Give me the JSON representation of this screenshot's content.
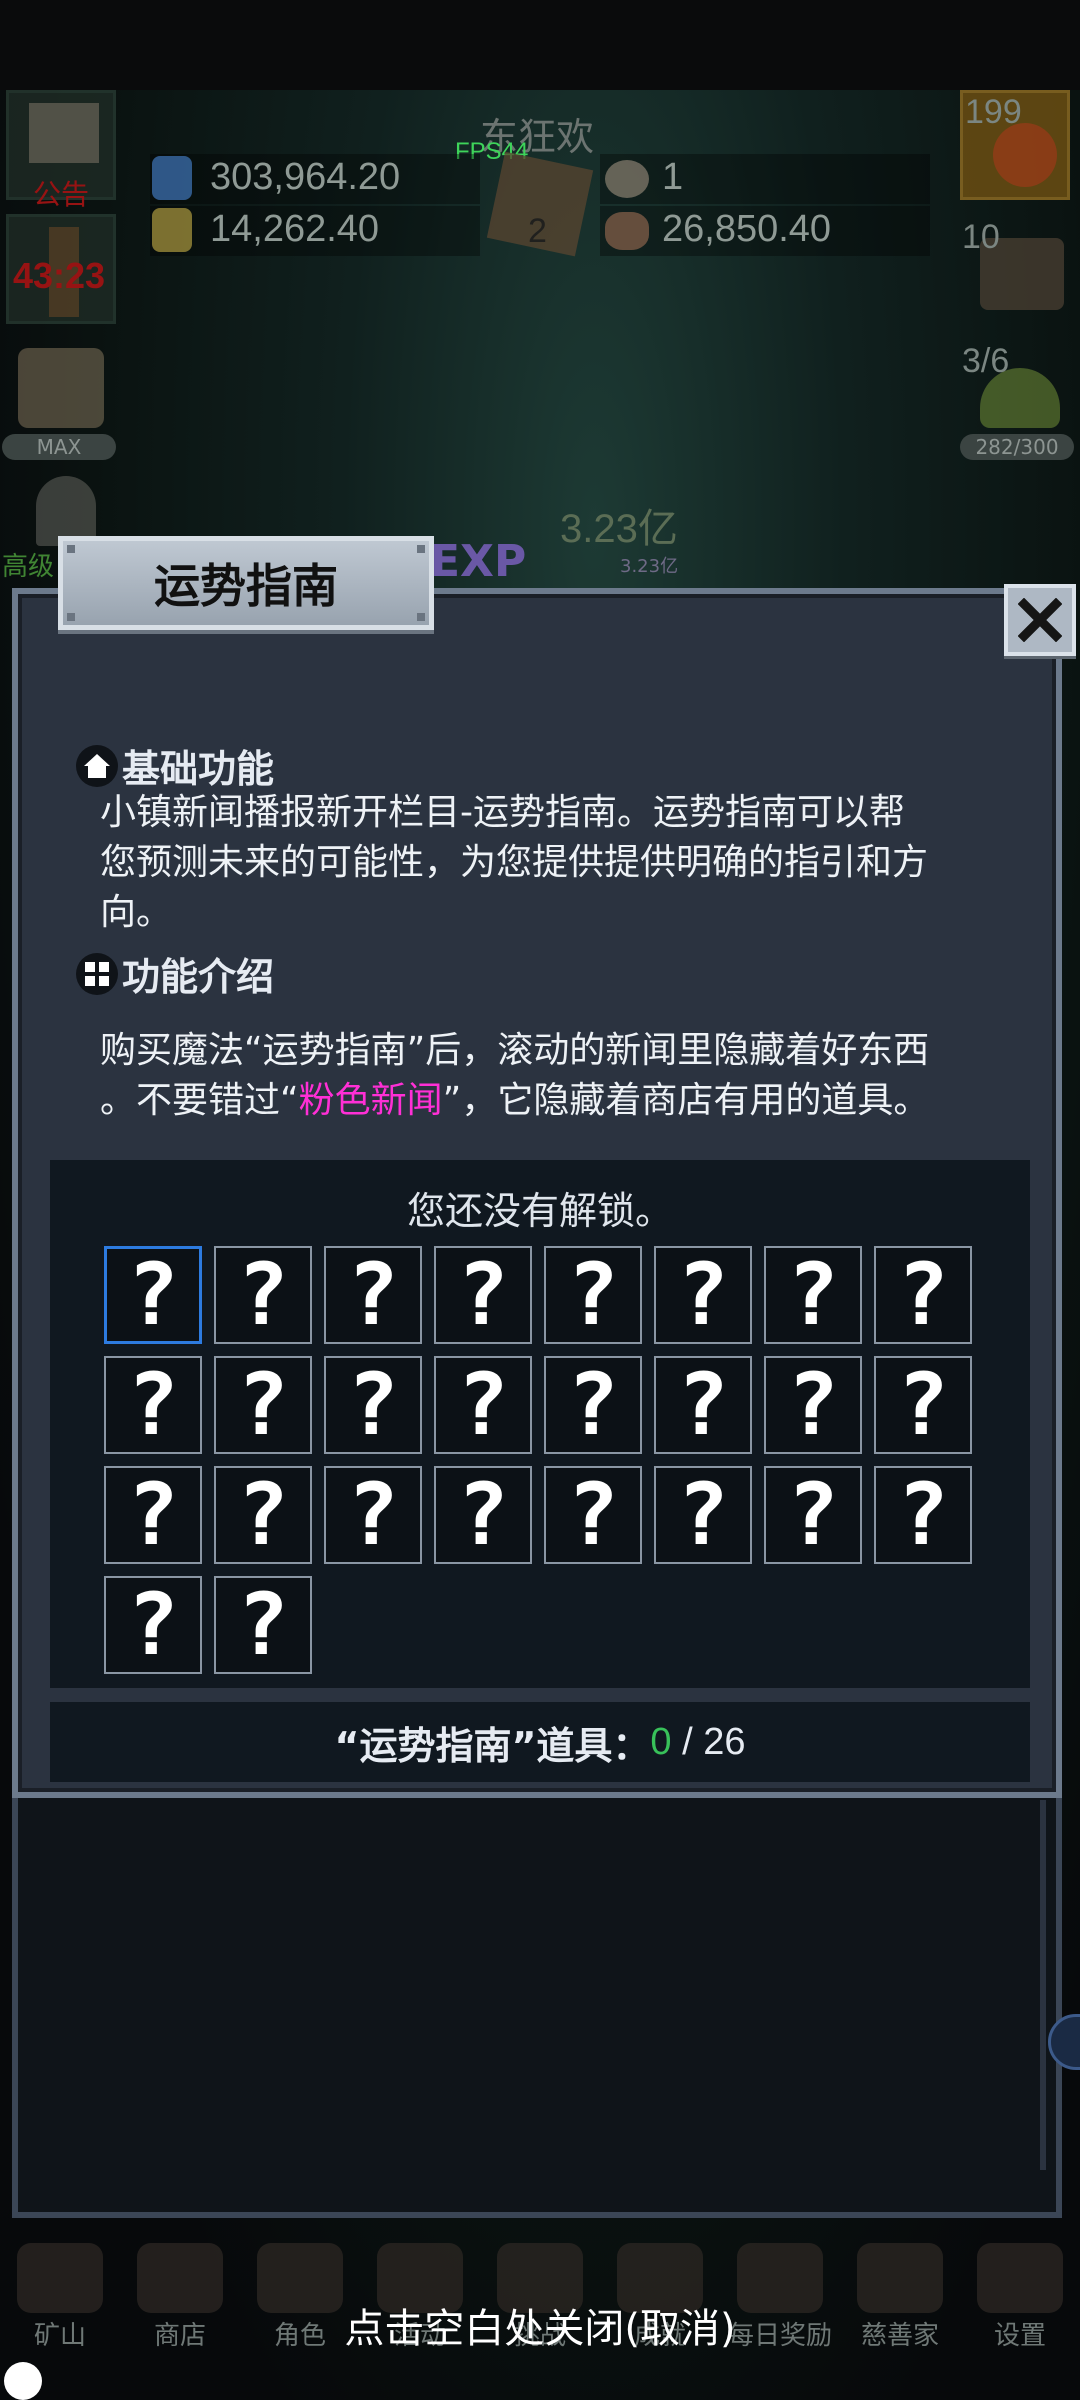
{
  "hud": {
    "event_title": "东狂欢",
    "fps": "FPS44",
    "res1": "303,964.20",
    "res2": "14,262.40",
    "res3": "1",
    "res4": "26,850.40",
    "book_count": "2",
    "notice_label": "公告",
    "timer": "43:23",
    "max_label": "MAX",
    "left4_label": "高级",
    "potion_count": "199",
    "chest_count": "10",
    "slime_count": "3/6",
    "slime_progress": "282/300",
    "bg_amount": "3.23亿",
    "bg_amount_small": "3.23亿",
    "bg_exp": "EXP"
  },
  "dialog": {
    "title": "运势指南",
    "close_icon": "close-x",
    "section1_title": "基础功能",
    "section1_text": "小镇新闻播报新开栏目-运势指南。运势指南可以帮您预测未来的可能性，为您提供提供明确的指引和方向。",
    "section1_line1": "小镇新闻播报新开栏目-运势指南。运势指南可以帮",
    "section1_line2": "您预测未来的可能性，为您提供提供明确的指引和方",
    "section1_line3": "向。",
    "section2_title": "功能介绍",
    "section2_line1": "购买魔法“运势指南”后，滚动的新闻里隐藏着好东西",
    "section2_line2_a": "。不要错过“",
    "section2_line2_pink": "粉色新闻",
    "section2_line2_b": "”，它隐藏着商店有用的道具。",
    "locked_message": "您还没有解锁。",
    "unknown_glyph": "?",
    "slot_count": 26,
    "counter_label": "“运势指南”道具：",
    "counter_value": "0",
    "counter_sep": " / ",
    "counter_total": "26",
    "colors": {
      "accent_pink": "#ff2fd6",
      "counter_green": "#38c15a",
      "selected_border": "#2d7be0"
    }
  },
  "nav": {
    "items": [
      {
        "label": "矿山",
        "icon": "lantern-icon"
      },
      {
        "label": "商店",
        "icon": "shop-icon"
      },
      {
        "label": "角色",
        "icon": "skull-icon"
      },
      {
        "label": "活动",
        "icon": "scroll-icon"
      },
      {
        "label": "挑战",
        "icon": "map-icon"
      },
      {
        "label": "成就",
        "icon": "key-icon"
      },
      {
        "label": "每日奖励",
        "icon": "envelope-icon"
      },
      {
        "label": "慈善家",
        "icon": "bread-icon"
      },
      {
        "label": "设置",
        "icon": "gear-icon"
      }
    ],
    "close_hint": "点击空白处关闭(取消)"
  }
}
